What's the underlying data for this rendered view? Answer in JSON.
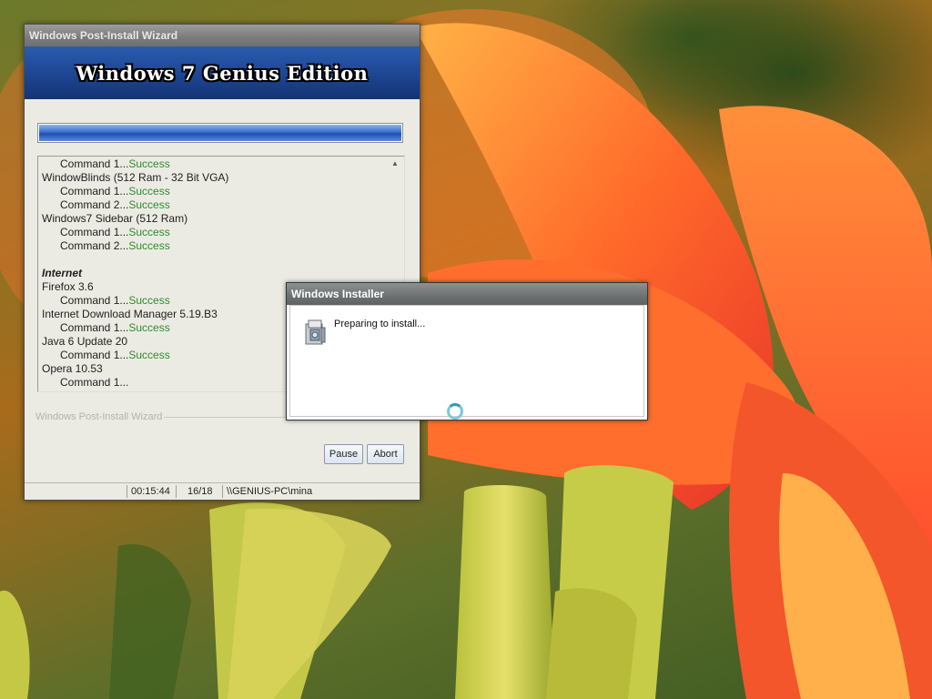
{
  "wizard": {
    "title": "Windows Post-Install Wizard",
    "banner_title": "Windows 7 Genius Edition",
    "progress_fraction": 1.0,
    "log": [
      {
        "kind": "cmd",
        "text": "Command 1...",
        "status": "Success"
      },
      {
        "kind": "app",
        "text": "WindowBlinds (512 Ram - 32 Bit VGA)"
      },
      {
        "kind": "cmd",
        "text": "Command 1...",
        "status": "Success"
      },
      {
        "kind": "cmd",
        "text": "Command 2...",
        "status": "Success"
      },
      {
        "kind": "app",
        "text": "Windows7 Sidebar (512 Ram)"
      },
      {
        "kind": "cmd",
        "text": "Command 1...",
        "status": "Success"
      },
      {
        "kind": "cmd",
        "text": "Command 2...",
        "status": "Success"
      },
      {
        "kind": "blank",
        "text": ""
      },
      {
        "kind": "section",
        "text": "Internet"
      },
      {
        "kind": "app",
        "text": "Firefox 3.6"
      },
      {
        "kind": "cmd",
        "text": "Command 1...",
        "status": "Success"
      },
      {
        "kind": "app",
        "text": "Internet Download Manager 5.19.B3"
      },
      {
        "kind": "cmd",
        "text": "Command 1...",
        "status": "Success"
      },
      {
        "kind": "app",
        "text": "Java 6 Update 20"
      },
      {
        "kind": "cmd",
        "text": "Command 1...",
        "status": "Success"
      },
      {
        "kind": "app",
        "text": "Opera 10.53"
      },
      {
        "kind": "cmd",
        "text": "Command 1...",
        "status": ""
      }
    ],
    "group_label": "Windows Post-Install Wizard",
    "pause_label": "Pause",
    "abort_label": "Abort",
    "status": {
      "elapsed": "00:15:44",
      "count": "16/18",
      "user": "\\\\GENIUS-PC\\mina"
    }
  },
  "installer": {
    "title": "Windows Installer",
    "message": "Preparing to install..."
  },
  "colors": {
    "success": "#2e8b2e",
    "banner": "#1a3f88",
    "titlebar": "#7b7b7b"
  },
  "icons": [
    "installer-box-icon",
    "scroll-up-icon",
    "busy-cursor-icon"
  ]
}
